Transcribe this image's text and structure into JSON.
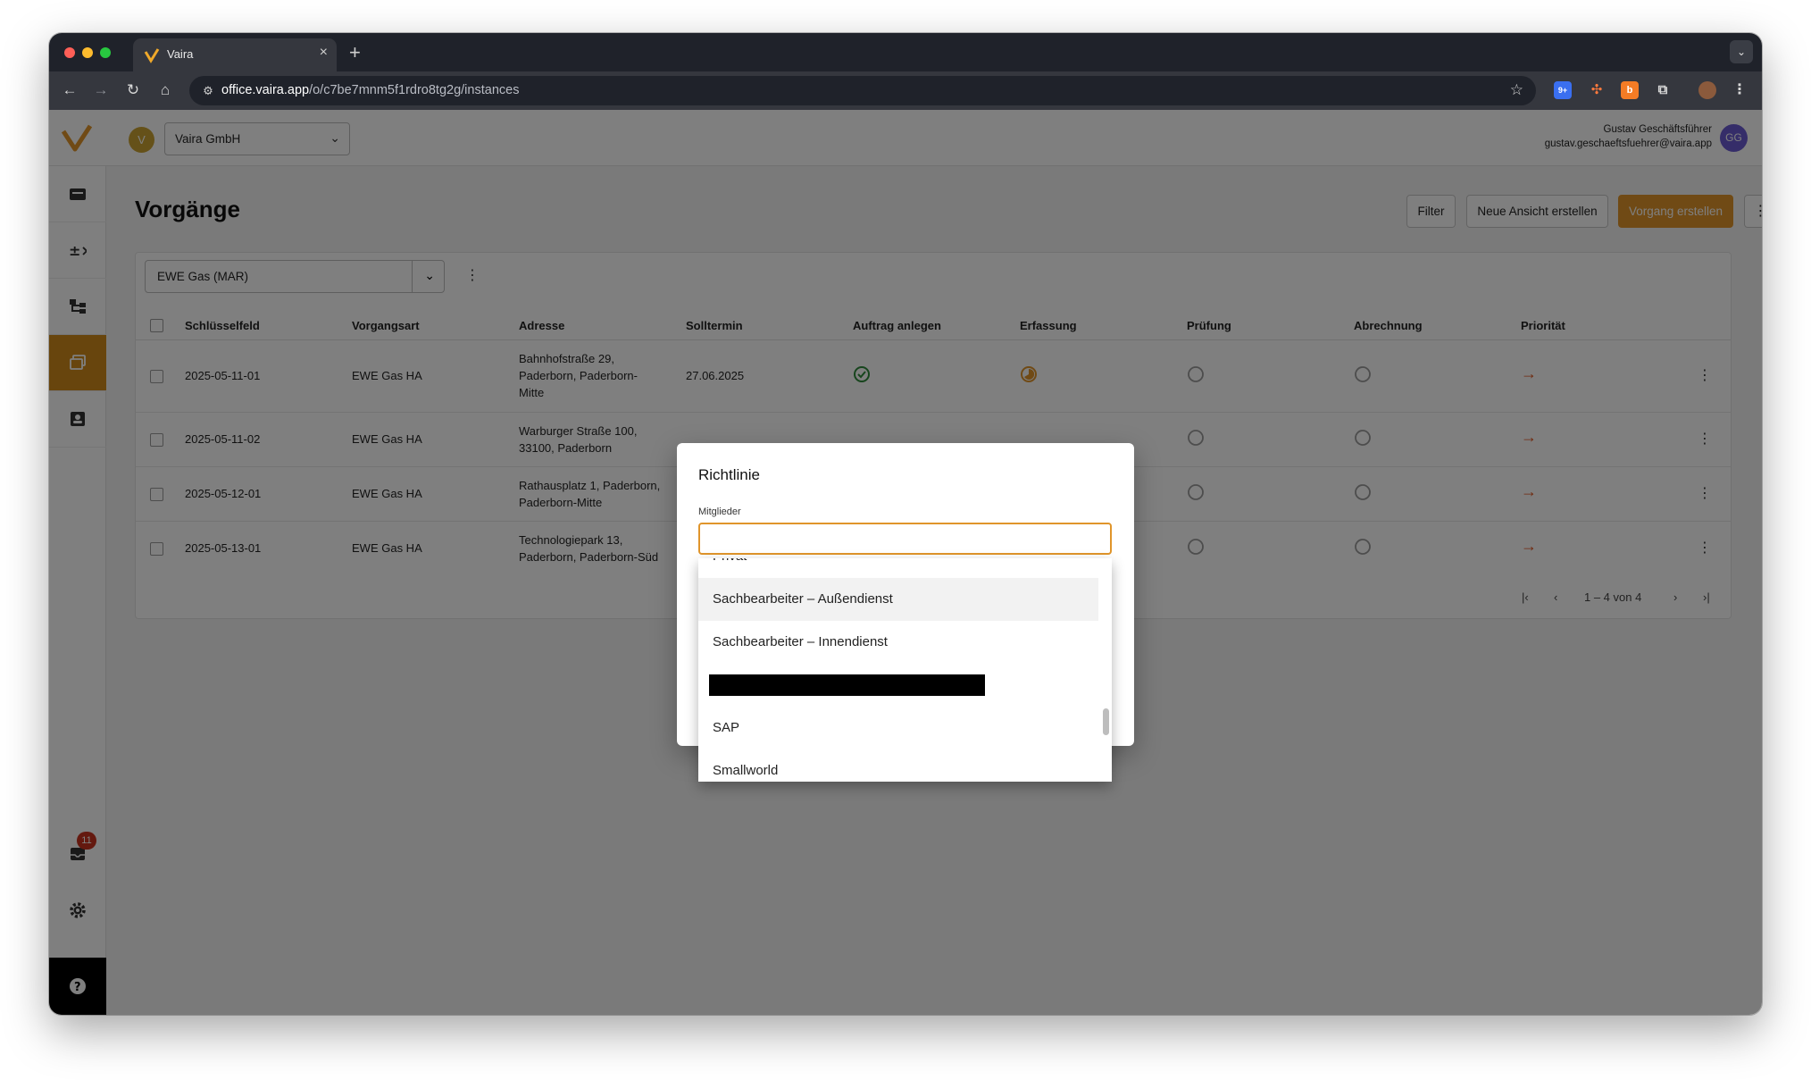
{
  "browser": {
    "tab_title": "Vaira",
    "url_host": "office.vaira.app",
    "url_path": "/o/c7be7mnm5f1rdro8tg2g/instances",
    "new_tab_label": "+",
    "close_label": "×",
    "extension_badge": "9+"
  },
  "org": {
    "initial": "V",
    "name": "Vaira GmbH"
  },
  "user": {
    "name": "Gustav Geschäftsführer",
    "email": "gustav.geschaeftsfuehrer@vaira.app",
    "initials": "GG"
  },
  "sidebar": {
    "inbox_badge": "11"
  },
  "page": {
    "title": "Vorgänge",
    "buttons": {
      "filter": "Filter",
      "new_view": "Neue Ansicht erstellen",
      "create": "Vorgang erstellen"
    }
  },
  "view": {
    "selected": "EWE Gas (MAR)"
  },
  "table": {
    "headers": [
      "Schlüsselfeld",
      "Vorgangsart",
      "Adresse",
      "Solltermin",
      "Auftrag anlegen",
      "Erfassung",
      "Prüfung",
      "Abrechnung",
      "Priorität"
    ],
    "rows": [
      {
        "key": "2025-05-11-01",
        "type": "EWE Gas HA",
        "address": "Bahnhofstraße 29, Paderborn, Paderborn-Mitte",
        "date": "27.06.2025"
      },
      {
        "key": "2025-05-11-02",
        "type": "EWE Gas HA",
        "address": "Warburger Straße 100, 33100, Paderborn",
        "date": ""
      },
      {
        "key": "2025-05-12-01",
        "type": "EWE Gas HA",
        "address": "Rathausplatz 1, Paderborn, Paderborn-Mitte",
        "date": ""
      },
      {
        "key": "2025-05-13-01",
        "type": "EWE Gas HA",
        "address": "Technologiepark 13, Paderborn, Paderborn-Süd",
        "date": ""
      }
    ],
    "pagination": "1 – 4 von 4"
  },
  "dialog": {
    "title": "Richtlinie",
    "field_label": "Mitglieder",
    "input_value": "",
    "options": [
      "Sachbearbeiter – Außendienst",
      "Sachbearbeiter – Innendienst",
      "SAP",
      "Smallworld"
    ]
  },
  "colors": {
    "accent": "#e0952b",
    "priority": "#e0541f",
    "success": "#2e8b3a",
    "avatar": "#6b5bd2"
  }
}
